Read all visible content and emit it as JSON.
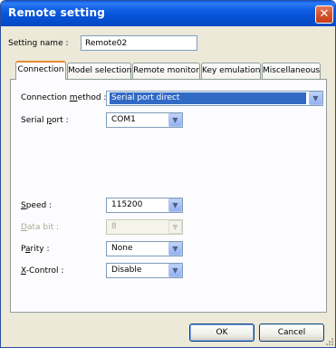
{
  "window": {
    "title": "Remote setting"
  },
  "setting_name": {
    "label": "Setting name :",
    "value": "Remote02"
  },
  "tabs": [
    {
      "label": "Connection",
      "active": true
    },
    {
      "label": "Model selection",
      "active": false
    },
    {
      "label": "Remote monitor",
      "active": false
    },
    {
      "label": "Key emulation",
      "active": false
    },
    {
      "label": "Miscellaneous",
      "active": false
    }
  ],
  "connection": {
    "connection_method": {
      "label_pre": "Connection ",
      "label_ul": "m",
      "label_post": "ethod :",
      "value": "Serial port direct"
    },
    "serial_port": {
      "label_pre": "Serial ",
      "label_ul": "p",
      "label_post": "ort :",
      "value": "COM1"
    },
    "speed": {
      "label_ul": "S",
      "label_post": "peed :",
      "value": "115200"
    },
    "data_bit": {
      "label_ul": "D",
      "label_post": "ata bit :",
      "value": "8",
      "disabled": true
    },
    "parity": {
      "label_pre": "P",
      "label_ul": "a",
      "label_post": "rity :",
      "value": "None"
    },
    "x_control": {
      "label_ul": "X",
      "label_post": "-Control :",
      "value": "Disable"
    }
  },
  "buttons": {
    "ok": "OK",
    "cancel": "Cancel"
  },
  "colors": {
    "title_bar": "#0653d6",
    "selection": "#316ac5",
    "active_tab_accent": "#e68b2c",
    "close_button": "#d5532f"
  }
}
